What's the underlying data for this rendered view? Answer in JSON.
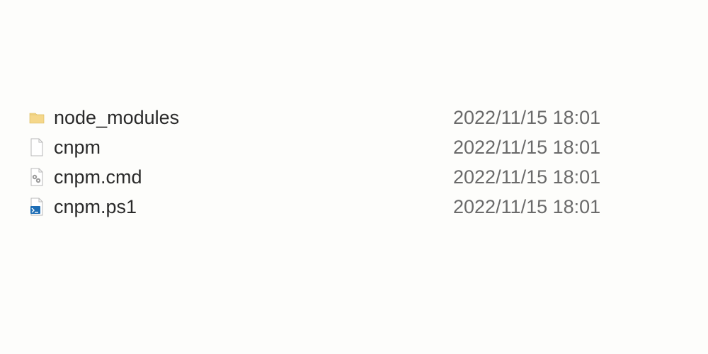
{
  "files": [
    {
      "name": "node_modules",
      "date": "2022/11/15 18:01",
      "icon": "folder"
    },
    {
      "name": "cnpm",
      "date": "2022/11/15 18:01",
      "icon": "blank"
    },
    {
      "name": "cnpm.cmd",
      "date": "2022/11/15 18:01",
      "icon": "cmd"
    },
    {
      "name": "cnpm.ps1",
      "date": "2022/11/15 18:01",
      "icon": "ps1"
    }
  ]
}
